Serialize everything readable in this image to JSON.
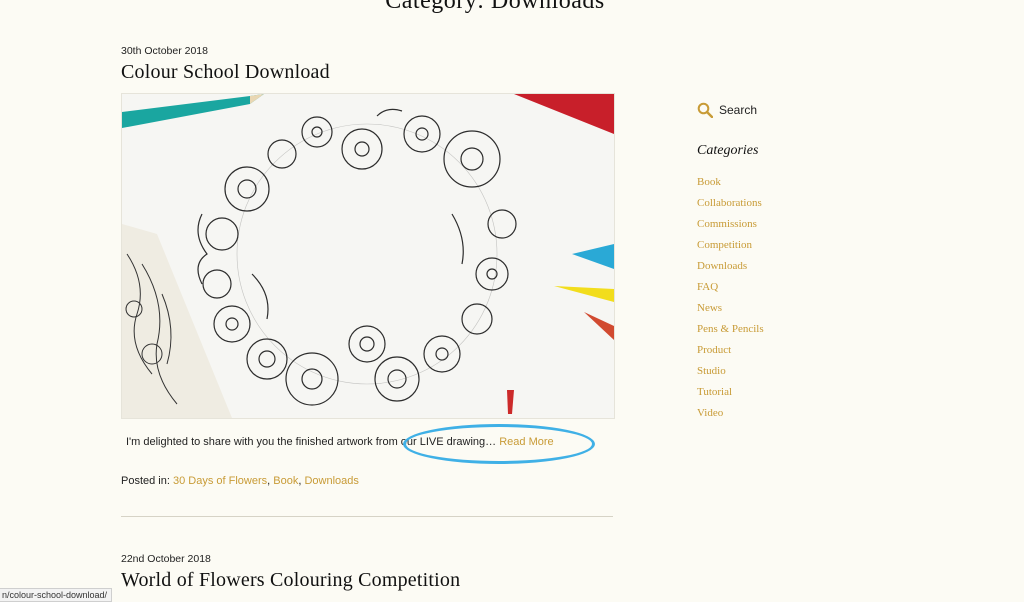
{
  "page": {
    "title": "Category: Downloads"
  },
  "posts": [
    {
      "date": "30th October 2018",
      "title": "Colour School Download",
      "excerpt": "I'm delighted to share with you the finished artwork from our LIVE drawing…",
      "read_more": "Read More",
      "posted_in_label": "Posted in:",
      "categories": [
        "30 Days of Flowers",
        "Book",
        "Downloads"
      ]
    },
    {
      "date": "22nd October 2018",
      "title": "World of Flowers Colouring Competition"
    }
  ],
  "sidebar": {
    "search_label": "Search",
    "categories_heading": "Categories",
    "categories": [
      "Book",
      "Collaborations",
      "Commissions",
      "Competition",
      "Downloads",
      "FAQ",
      "News",
      "Pens & Pencils",
      "Product",
      "Studio",
      "Tutorial",
      "Video"
    ]
  },
  "status_bar": {
    "url": "n/colour-school-download/"
  },
  "colors": {
    "accent": "#c89b36",
    "highlight": "#3fb0e6",
    "background": "#fcfbf4"
  }
}
